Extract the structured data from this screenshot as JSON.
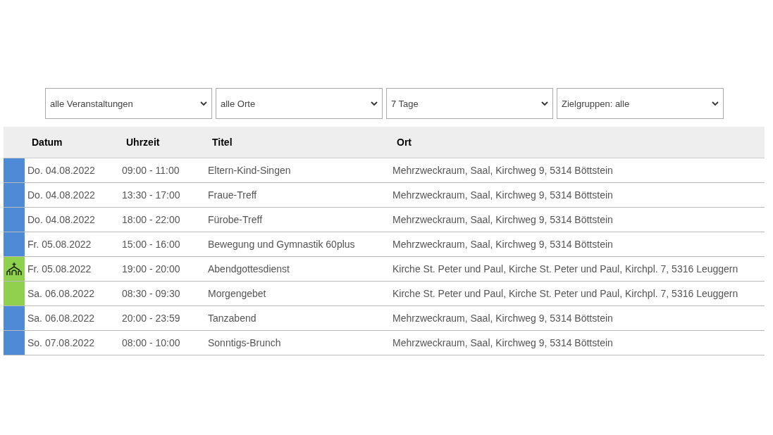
{
  "filters": [
    {
      "value": "alle Veranstaltungen"
    },
    {
      "value": "alle Orte"
    },
    {
      "value": "7 Tage"
    },
    {
      "value": "Zielgruppen: alle"
    }
  ],
  "table": {
    "columns": [
      "Datum",
      "Uhrzeit",
      "Titel",
      "Ort"
    ],
    "rows": [
      {
        "kind": "plain",
        "color": "#4f8ad6",
        "datum": "Do. 04.08.2022",
        "uhrzeit": "09:00 - 11:00",
        "titel": "Eltern-Kind-Singen",
        "ort": "Mehrzweckraum, Saal, Kirchweg 9, 5314 Böttstein"
      },
      {
        "kind": "plain",
        "color": "#4f8ad6",
        "datum": "Do. 04.08.2022",
        "uhrzeit": "13:30 - 17:00",
        "titel": "Fraue-Treff",
        "ort": "Mehrzweckraum, Saal, Kirchweg 9, 5314 Böttstein"
      },
      {
        "kind": "plain",
        "color": "#4f8ad6",
        "datum": "Do. 04.08.2022",
        "uhrzeit": "18:00 - 22:00",
        "titel": "Fürobe-Treff",
        "ort": "Mehrzweckraum, Saal, Kirchweg 9, 5314 Böttstein"
      },
      {
        "kind": "plain",
        "color": "#4f8ad6",
        "datum": "Fr. 05.08.2022",
        "uhrzeit": "15:00 - 16:00",
        "titel": "Bewegung und Gymnastik 60plus",
        "ort": "Mehrzweckraum, Saal, Kirchweg 9, 5314 Böttstein"
      },
      {
        "kind": "church",
        "color": "#8fd14f",
        "datum": "Fr. 05.08.2022",
        "uhrzeit": "19:00 - 20:00",
        "titel": "Abendgottesdienst",
        "ort": "Kirche St. Peter und Paul, Kirche St. Peter und Paul, Kirchpl. 7, 5316 Leuggern"
      },
      {
        "kind": "plain",
        "color": "#8fd14f",
        "datum": "Sa. 06.08.2022",
        "uhrzeit": "08:30 - 09:30",
        "titel": "Morgengebet",
        "ort": "Kirche St. Peter und Paul, Kirche St. Peter und Paul, Kirchpl. 7, 5316 Leuggern"
      },
      {
        "kind": "plain",
        "color": "#4f8ad6",
        "datum": "Sa. 06.08.2022",
        "uhrzeit": "20:00 - 23:59",
        "titel": "Tanzabend",
        "ort": "Mehrzweckraum, Saal, Kirchweg 9, 5314 Böttstein"
      },
      {
        "kind": "plain",
        "color": "#4f8ad6",
        "datum": "So. 07.08.2022",
        "uhrzeit": "08:00 - 10:00",
        "titel": "Sonntigs-Brunch",
        "ort": "Mehrzweckraum, Saal, Kirchweg 9, 5314 Böttstein"
      }
    ]
  }
}
